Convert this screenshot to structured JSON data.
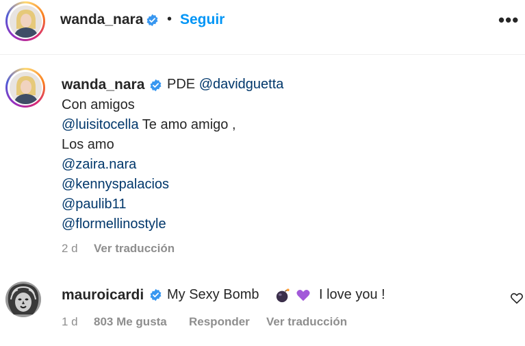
{
  "header": {
    "username": "wanda_nara",
    "separator": "•",
    "follow_label": "Seguir",
    "more_label": "•••"
  },
  "caption": {
    "username": "wanda_nara",
    "first_line_text": "PDE ",
    "first_line_mention": "@davidguetta",
    "lines": [
      {
        "text": "Con amigos",
        "mention": false
      },
      {
        "text": "@luisitocella",
        "mention": true,
        "suffix": " Te amo amigo ,"
      },
      {
        "text": "Los amo",
        "mention": false
      },
      {
        "text": "@zaira.nara",
        "mention": true
      },
      {
        "text": "@kennyspalacios",
        "mention": true
      },
      {
        "text": "@paulib11",
        "mention": true
      },
      {
        "text": "@flormellinostyle",
        "mention": true
      }
    ],
    "time": "2 d",
    "translate_label": "Ver traducción"
  },
  "comment": {
    "username": "mauroicardi",
    "text_before": "My Sexy Bomb",
    "text_after": "I love you !",
    "emojis": [
      "bomb-emoji",
      "purple-heart-emoji"
    ],
    "time": "1 d",
    "likes": "803 Me gusta",
    "reply_label": "Responder",
    "translate_label": "Ver traducción"
  },
  "colors": {
    "link": "#00376b",
    "follow": "#0095f6",
    "verified": "#3897f0",
    "meta": "#8e8e8e"
  }
}
